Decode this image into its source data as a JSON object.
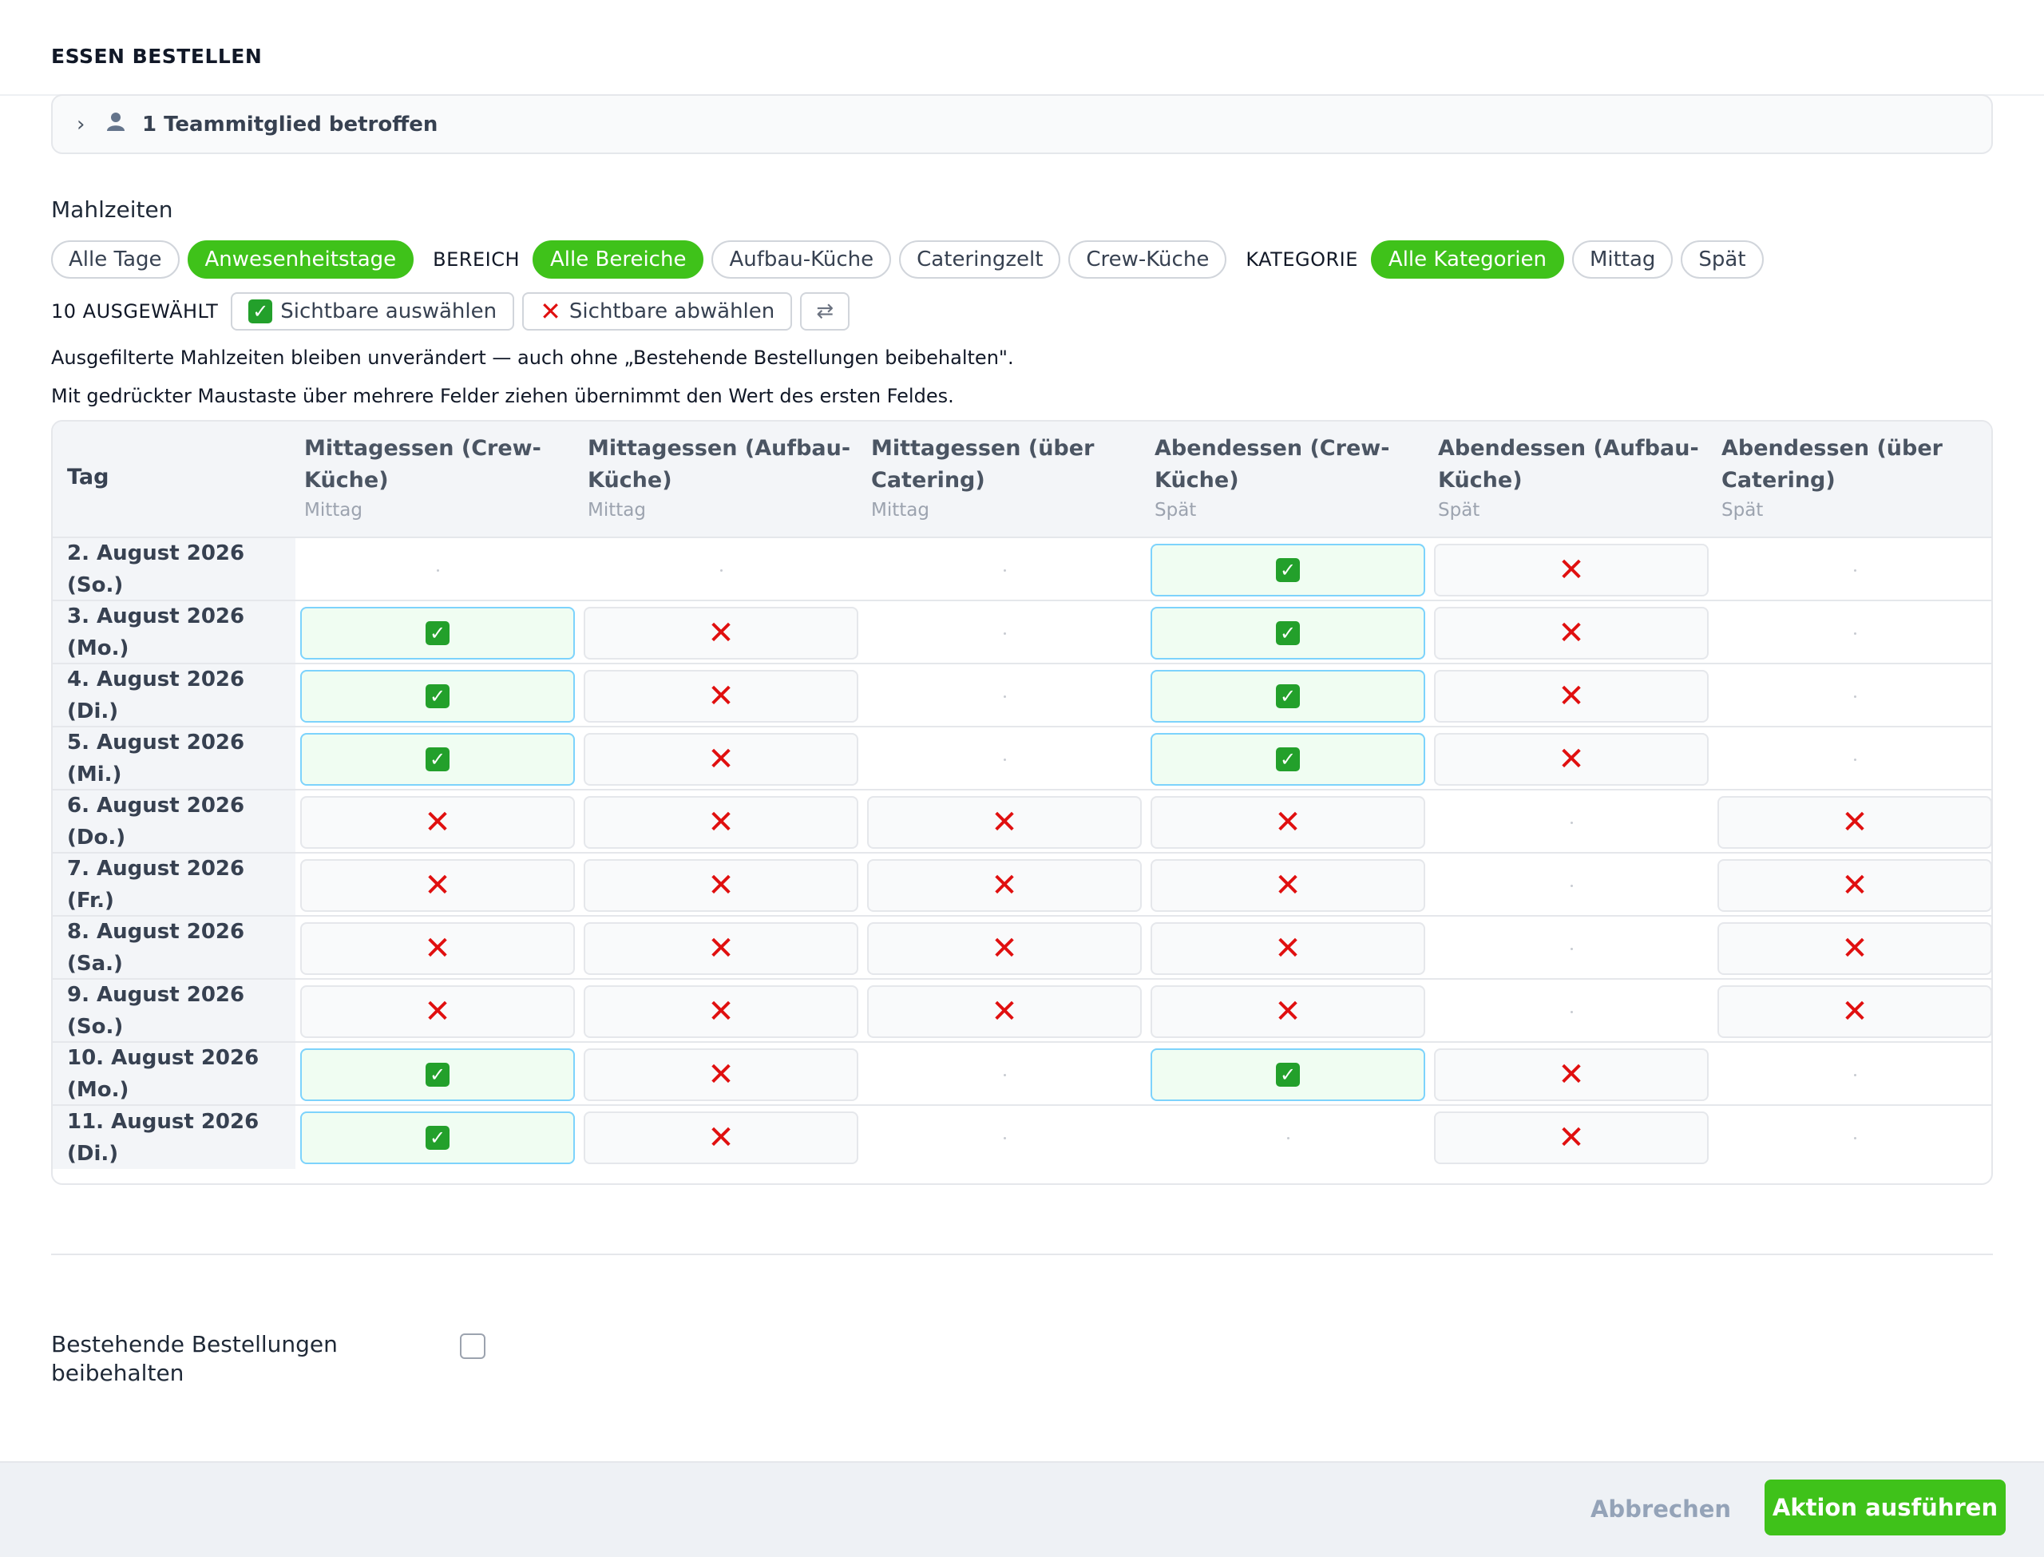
{
  "modal": {
    "title": "ESSEN BESTELLEN"
  },
  "affected": {
    "chevron": "chevron-right-icon",
    "icon": "person-icon",
    "label": "1 Teammitglied betroffen"
  },
  "meals": {
    "section_title": "Mahlzeiten",
    "day_filters": [
      {
        "label": "Alle Tage",
        "active": false
      },
      {
        "label": "Anwesenheitstage",
        "active": true
      }
    ],
    "area_label": "BEREICH",
    "area_filters": [
      {
        "label": "Alle Bereiche",
        "active": true
      },
      {
        "label": "Aufbau-Küche",
        "active": false
      },
      {
        "label": "Cateringzelt",
        "active": false
      },
      {
        "label": "Crew-Küche",
        "active": false
      }
    ],
    "category_label": "KATEGORIE",
    "category_filters": [
      {
        "label": "Alle Kategorien",
        "active": true
      },
      {
        "label": "Mittag",
        "active": false
      },
      {
        "label": "Spät",
        "active": false
      }
    ],
    "selected_count": "10 AUSGEWÄHLT",
    "select_visible": "Sichtbare auswählen",
    "deselect_visible": "Sichtbare abwählen",
    "swap_icon": "swap-icon",
    "note_filtered": "Ausgefilterte Mahlzeiten bleiben unverändert — auch ohne „Bestehende Bestellungen beibehalten\".",
    "note_drag": "Mit gedrückter Maustaste über mehrere Felder ziehen übernimmt den Wert des ersten Feldes."
  },
  "grid": {
    "day_header": "Tag",
    "columns": [
      {
        "name": "Mittagessen (Crew-Küche)",
        "category": "Mittag"
      },
      {
        "name": "Mittagessen (Aufbau-Küche)",
        "category": "Mittag"
      },
      {
        "name": "Mittagessen (über Catering)",
        "category": "Mittag"
      },
      {
        "name": "Abendessen (Crew-Küche)",
        "category": "Spät"
      },
      {
        "name": "Abendessen (Aufbau-Küche)",
        "category": "Spät"
      },
      {
        "name": "Abendessen (über Catering)",
        "category": "Spät"
      }
    ],
    "rows": [
      {
        "day": "2. August 2026 (So.)",
        "cells": [
          "none",
          "none",
          "none",
          "yes",
          "no",
          "none"
        ]
      },
      {
        "day": "3. August 2026 (Mo.)",
        "cells": [
          "yes",
          "no",
          "none",
          "yes",
          "no",
          "none"
        ]
      },
      {
        "day": "4. August 2026 (Di.)",
        "cells": [
          "yes",
          "no",
          "none",
          "yes",
          "no",
          "none"
        ]
      },
      {
        "day": "5. August 2026 (Mi.)",
        "cells": [
          "yes",
          "no",
          "none",
          "yes",
          "no",
          "none"
        ]
      },
      {
        "day": "6. August 2026 (Do.)",
        "cells": [
          "no",
          "no",
          "no",
          "no",
          "none",
          "no"
        ]
      },
      {
        "day": "7. August 2026 (Fr.)",
        "cells": [
          "no",
          "no",
          "no",
          "no",
          "none",
          "no"
        ]
      },
      {
        "day": "8. August 2026 (Sa.)",
        "cells": [
          "no",
          "no",
          "no",
          "no",
          "none",
          "no"
        ]
      },
      {
        "day": "9. August 2026 (So.)",
        "cells": [
          "no",
          "no",
          "no",
          "no",
          "none",
          "no"
        ]
      },
      {
        "day": "10. August 2026 (Mo.)",
        "cells": [
          "yes",
          "no",
          "none",
          "yes",
          "no",
          "none"
        ]
      },
      {
        "day": "11. August 2026 (Di.)",
        "cells": [
          "yes",
          "no",
          "none",
          "none",
          "no",
          "none"
        ]
      }
    ]
  },
  "options": {
    "keep_orders_label": "Bestehende Bestellungen beibehalten",
    "keep_orders_checked": false
  },
  "footer": {
    "cancel_label": "Abbrechen",
    "submit_label": "Aktion ausführen"
  },
  "colors": {
    "accent": "#3fc21a",
    "check": "#23a02b",
    "cross": "#e00f0f"
  }
}
